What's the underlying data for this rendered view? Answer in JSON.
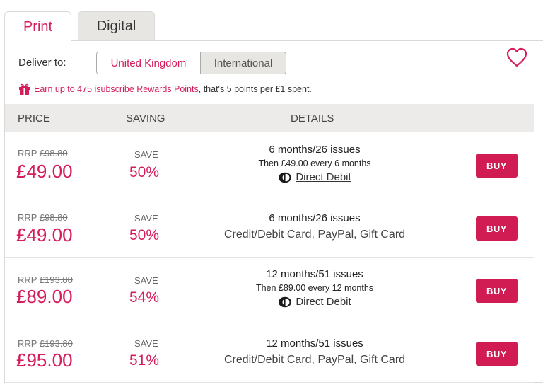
{
  "tabs": {
    "print": "Print",
    "digital": "Digital"
  },
  "deliver": {
    "label": "Deliver to:",
    "uk": "United Kingdom",
    "international": "International"
  },
  "rewards": {
    "link": "Earn up to 475 isubscribe Rewards Points",
    "rest": ", that's 5 points per £1 spent."
  },
  "table": {
    "price": "PRICE",
    "saving": "SAVING",
    "details": "DETAILS"
  },
  "colors": {
    "accent": "#d51d5a",
    "buy": "#d01c53",
    "header_bg": "#ecebe9"
  },
  "offers": [
    {
      "rrp_label": "RRP",
      "rrp": "£98.80",
      "price": "£49.00",
      "save_label": "SAVE",
      "save_pct": "50%",
      "term": "6 months/26 issues",
      "then": "Then £49.00 every 6 months",
      "method": "Direct Debit",
      "buy": "BUY"
    },
    {
      "rrp_label": "RRP",
      "rrp": "£98.80",
      "price": "£49.00",
      "save_label": "SAVE",
      "save_pct": "50%",
      "term": "6 months/26 issues",
      "method": "Credit/Debit Card, PayPal, Gift Card",
      "buy": "BUY"
    },
    {
      "rrp_label": "RRP",
      "rrp": "£193.80",
      "price": "£89.00",
      "save_label": "SAVE",
      "save_pct": "54%",
      "term": "12 months/51 issues",
      "then": "Then £89.00 every 12 months",
      "method": "Direct Debit",
      "buy": "BUY"
    },
    {
      "rrp_label": "RRP",
      "rrp": "£193.80",
      "price": "£95.00",
      "save_label": "SAVE",
      "save_pct": "51%",
      "term": "12 months/51 issues",
      "method": "Credit/Debit Card, PayPal, Gift Card",
      "buy": "BUY"
    }
  ]
}
